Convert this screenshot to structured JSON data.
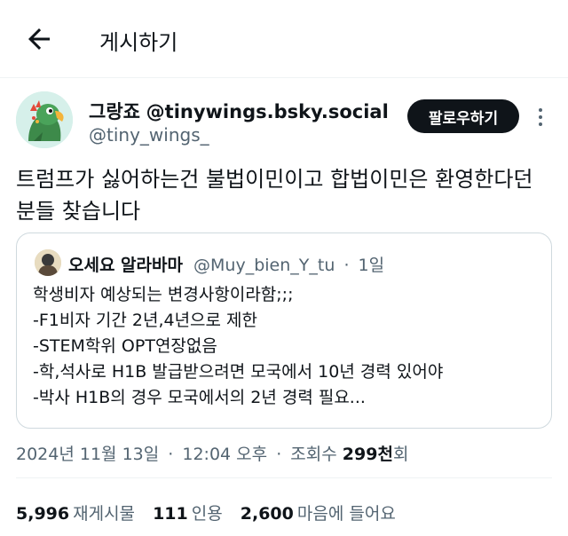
{
  "header": {
    "title": "게시하기",
    "back_icon": "arrow-left-icon"
  },
  "author": {
    "display_name": "그랑죠",
    "display_handle": "@tinywings.bsky.social",
    "username": "@tiny_wings_",
    "avatar_icon": "parrot-avatar",
    "follow_label": "팔로우하기",
    "more_icon": "more-vertical-icon"
  },
  "post": {
    "text": "트럼프가 싫어하는건 불법이민이고 합법이민은 환영한다던 분들 찾습니다"
  },
  "quote": {
    "name": "오세요 알라바마",
    "handle": "@Muy_bien_Y_tu",
    "dot": "·",
    "time": "1일",
    "lines": [
      "학생비자 예상되는 변경사항이라함;;;",
      "-F1비자 기간 2년,4년으로 제한",
      "-STEM학위 OPT연장없음",
      "-학,석사로 H1B 발급받으려면 모국에서 10년 경력 있어야",
      "-박사 H1B의 경우 모국에서의 2년 경력 필요..."
    ]
  },
  "meta": {
    "date": "2024년 11월 13일",
    "sep": "·",
    "time": "12:04 오후",
    "views_label": "조회수",
    "views_count": "299천",
    "views_suffix": "회"
  },
  "stats": {
    "reposts_count": "5,996",
    "reposts_label": "재게시물",
    "quotes_count": "111",
    "quotes_label": "인용",
    "likes_count": "2,600",
    "likes_label": "마음에 들어요"
  },
  "colors": {
    "text": "#0f1419",
    "secondary": "#536471",
    "border": "#cfd9de",
    "button_bg": "#0f1419"
  }
}
